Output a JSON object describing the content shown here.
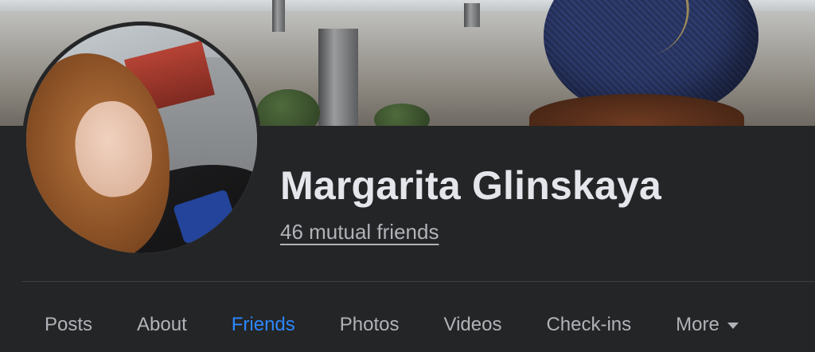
{
  "profile": {
    "name": "Margarita Glinskaya",
    "mutual_friends": "46 mutual friends"
  },
  "tabs": [
    {
      "label": "Posts",
      "active": false
    },
    {
      "label": "About",
      "active": false
    },
    {
      "label": "Friends",
      "active": true
    },
    {
      "label": "Photos",
      "active": false
    },
    {
      "label": "Videos",
      "active": false
    },
    {
      "label": "Check-ins",
      "active": false
    },
    {
      "label": "More",
      "active": false,
      "has_dropdown": true
    }
  ],
  "colors": {
    "background": "#242526",
    "primary_text": "#e4e6eb",
    "secondary_text": "#b0b3b8",
    "accent": "#2d88ff",
    "divider": "#3e4042"
  },
  "icons": {
    "more_dropdown": "chevron-down-icon"
  }
}
